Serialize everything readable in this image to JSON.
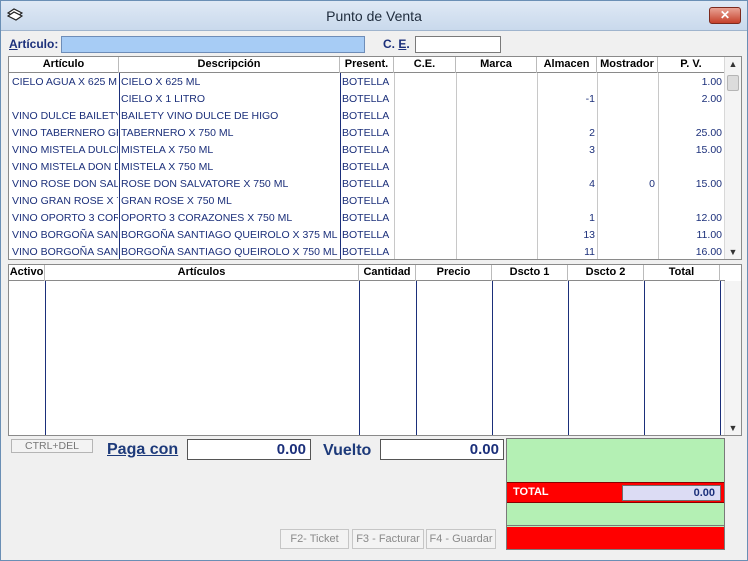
{
  "window": {
    "title": "Punto de Venta",
    "close_label": "✕"
  },
  "search": {
    "articulo_label_u": "A",
    "articulo_label_rest": "rtículo:",
    "articulo_value": "",
    "ce_label_pre": "C. ",
    "ce_label_u": "E",
    "ce_label_post": ".",
    "ce_value": ""
  },
  "products": {
    "columns": [
      "Artículo",
      "Descripción",
      "Present.",
      "C.E.",
      "Marca",
      "Almacen",
      "Mostrador",
      "P. V."
    ],
    "rows": [
      {
        "articulo": "CIELO AGUA X 625 M",
        "descripcion": "CIELO X 625 ML",
        "present": "BOTELLA",
        "ce": "",
        "marca": "",
        "almacen": "",
        "mostrador": "",
        "pv": "1.00"
      },
      {
        "articulo": "",
        "descripcion": "CIELO X 1 LITRO",
        "present": "BOTELLA",
        "ce": "",
        "marca": "",
        "almacen": "-1",
        "mostrador": "",
        "pv": "2.00"
      },
      {
        "articulo": "VINO DULCE BAILETY",
        "descripcion": "BAILETY VINO DULCE DE HIGO",
        "present": "BOTELLA",
        "ce": "",
        "marca": "",
        "almacen": "",
        "mostrador": "",
        "pv": ""
      },
      {
        "articulo": "VINO TABERNERO GR",
        "descripcion": "TABERNERO X 750 ML",
        "present": "BOTELLA",
        "ce": "",
        "marca": "",
        "almacen": "2",
        "mostrador": "",
        "pv": "25.00"
      },
      {
        "articulo": "VINO MISTELA DULCE",
        "descripcion": "MISTELA X 750 ML",
        "present": "BOTELLA",
        "ce": "",
        "marca": "",
        "almacen": "3",
        "mostrador": "",
        "pv": "15.00"
      },
      {
        "articulo": "VINO MISTELA DON D",
        "descripcion": "MISTELA X 750 ML",
        "present": "BOTELLA",
        "ce": "",
        "marca": "",
        "almacen": "",
        "mostrador": "",
        "pv": ""
      },
      {
        "articulo": "VINO ROSE DON SAL",
        "descripcion": "ROSE DON SALVATORE X 750 ML",
        "present": "BOTELLA",
        "ce": "",
        "marca": "",
        "almacen": "4",
        "mostrador": "0",
        "pv": "15.00"
      },
      {
        "articulo": "VINO GRAN ROSE X 7",
        "descripcion": "GRAN ROSE X 750 ML",
        "present": "BOTELLA",
        "ce": "",
        "marca": "",
        "almacen": "",
        "mostrador": "",
        "pv": ""
      },
      {
        "articulo": "VINO OPORTO 3 COR",
        "descripcion": "OPORTO 3 CORAZONES X 750 ML",
        "present": "BOTELLA",
        "ce": "",
        "marca": "",
        "almacen": "1",
        "mostrador": "",
        "pv": "12.00"
      },
      {
        "articulo": "VINO BORGOÑA  SAN",
        "descripcion": "BORGOÑA SANTIAGO QUEIROLO X 375 ML",
        "present": "BOTELLA",
        "ce": "",
        "marca": "",
        "almacen": "13",
        "mostrador": "",
        "pv": "11.00"
      },
      {
        "articulo": "VINO BORGOÑA  SAN",
        "descripcion": "BORGOÑA  SANTIAGO QUEIROLO X 750 ML",
        "present": "BOTELLA",
        "ce": "",
        "marca": "",
        "almacen": "11",
        "mostrador": "",
        "pv": "16.00"
      }
    ]
  },
  "cart": {
    "columns": [
      "Activo",
      "Artículos",
      "Cantidad",
      "Precio",
      "Dscto 1",
      "Dscto 2",
      "Total"
    ]
  },
  "payment": {
    "ctrl_del_label": "CTRL+DEL",
    "paga_con_label": "Paga con",
    "paga_con_value": "0.00",
    "vuelto_label": "Vuelto",
    "vuelto_value": "0.00",
    "total_label": "TOTAL",
    "total_value": "0.00"
  },
  "actions": {
    "ticket_label": "F2- Ticket",
    "facturar_label": "F3 - Facturar",
    "guardar_label": "F4 - Guardar"
  },
  "icons": {
    "app": "app-logo-icon",
    "close": "close-icon",
    "scroll_up": "scroll-up-icon",
    "scroll_down": "scroll-down-icon"
  },
  "colors": {
    "accent_text": "#1b2f7a",
    "total_red": "#ff0000",
    "panel_green": "#b4f0b4",
    "search_blue": "#a7ccf5"
  }
}
